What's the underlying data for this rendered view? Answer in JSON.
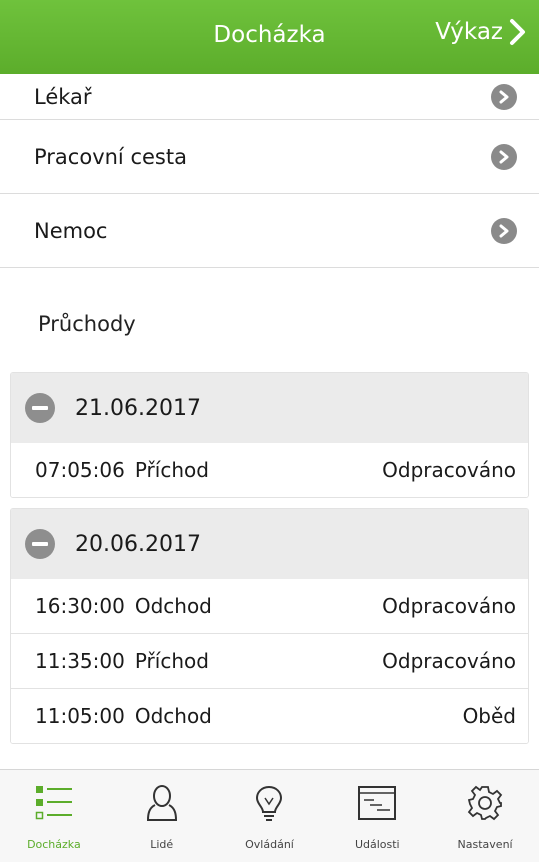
{
  "header": {
    "title": "Docházka",
    "report_label": "Výkaz"
  },
  "menu": [
    {
      "label": "Lékař"
    },
    {
      "label": "Pracovní cesta"
    },
    {
      "label": "Nemoc"
    }
  ],
  "passes_section": {
    "title": "Průchody"
  },
  "groups": [
    {
      "date": "21.06.2017",
      "rows": [
        {
          "time": "07:05:06",
          "type": "Příchod",
          "status": "Odpracováno"
        }
      ]
    },
    {
      "date": "20.06.2017",
      "rows": [
        {
          "time": "16:30:00",
          "type": "Odchod",
          "status": "Odpracováno"
        },
        {
          "time": "11:35:00",
          "type": "Příchod",
          "status": "Odpracováno"
        },
        {
          "time": "11:05:00",
          "type": "Odchod",
          "status": "Oběd"
        }
      ]
    }
  ],
  "tabs": [
    {
      "label": "Docházka",
      "icon": "checklist-icon",
      "active": true
    },
    {
      "label": "Lidé",
      "icon": "person-icon"
    },
    {
      "label": "Ovládání",
      "icon": "lightbulb-icon"
    },
    {
      "label": "Události",
      "icon": "events-icon"
    },
    {
      "label": "Nastavení",
      "icon": "gear-icon"
    }
  ],
  "colors": {
    "accent": "#5cad2b",
    "chevron_bg": "#8a8a8a"
  }
}
